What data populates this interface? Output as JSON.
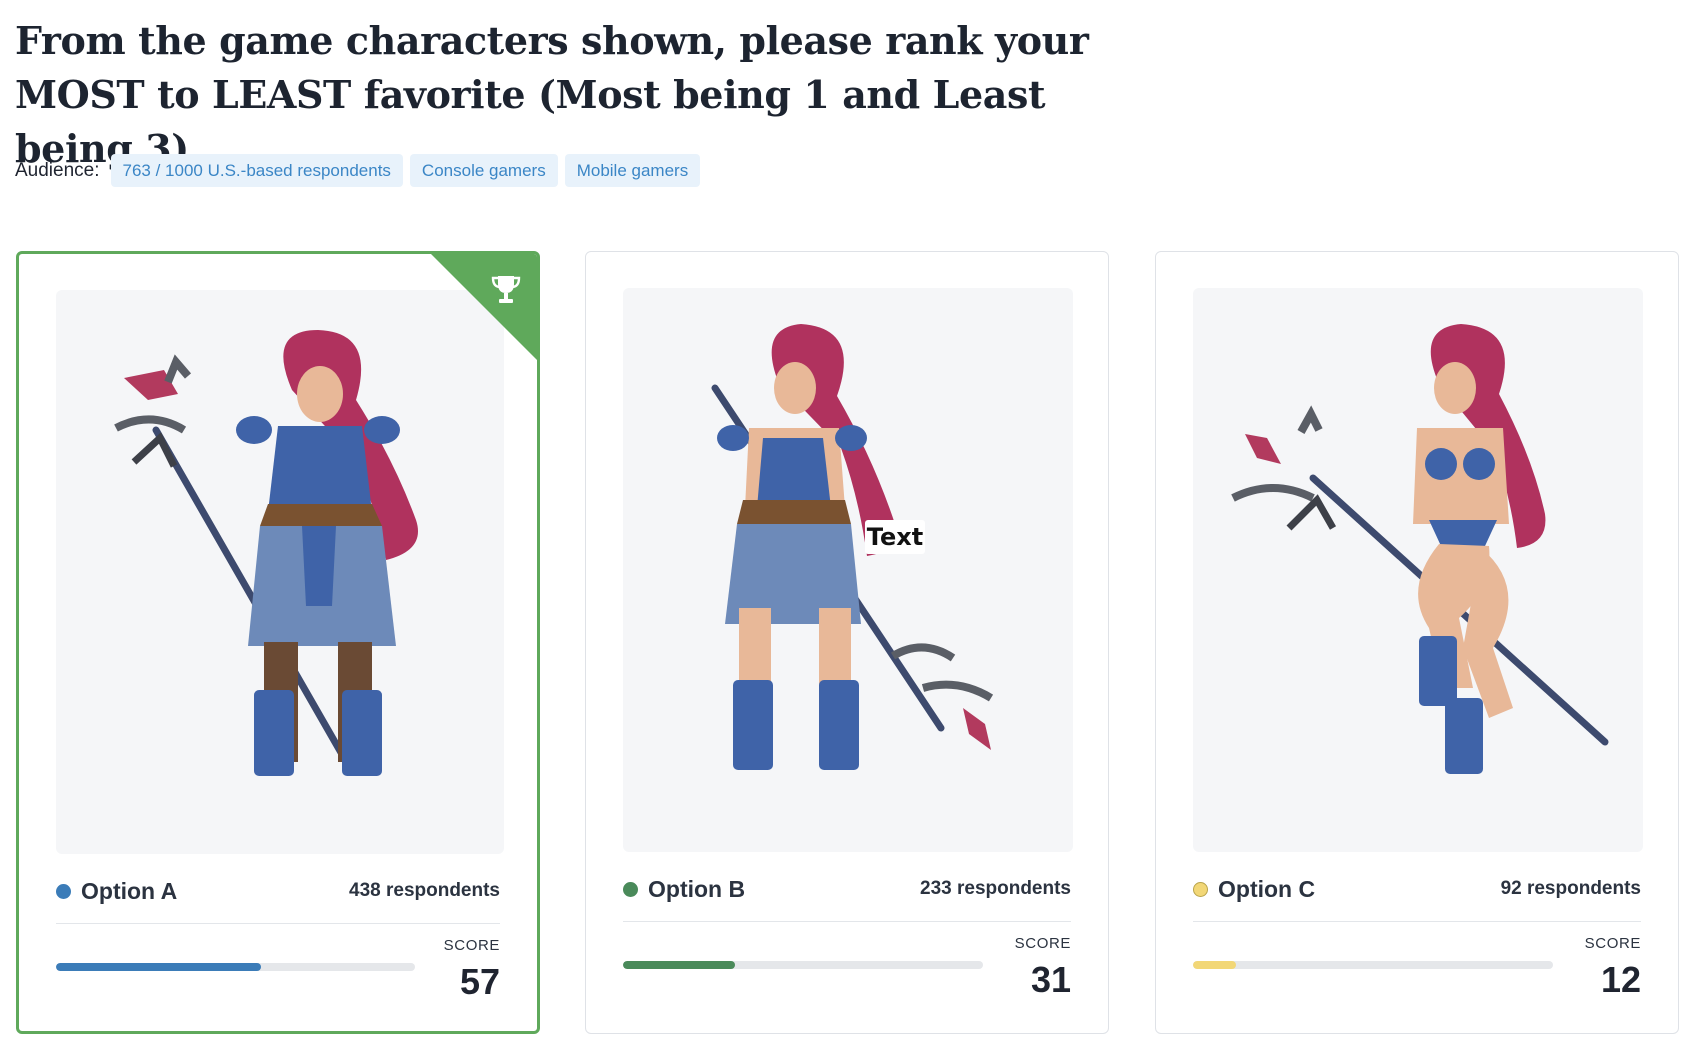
{
  "question": {
    "title": "From the game characters shown, please rank your MOST to LEAST favorite (Most being 1 and Least being 3)"
  },
  "audience": {
    "label": "Audience:",
    "chips": [
      "763 / 1000 U.S.-based respondents",
      "Console gamers",
      "Mobile gamers"
    ]
  },
  "options": [
    {
      "name": "Option A",
      "respondents": "438 respondents",
      "score_label": "SCORE",
      "score": "57",
      "score_fraction": 0.57,
      "color": "#3b7cb8",
      "winner": true,
      "winner_icon": "trophy-icon"
    },
    {
      "name": "Option B",
      "respondents": "233 respondents",
      "score_label": "SCORE",
      "score": "31",
      "score_fraction": 0.31,
      "color": "#4a8a5a",
      "winner": false,
      "image_overlay_text": "Text"
    },
    {
      "name": "Option C",
      "respondents": "92 respondents",
      "score_label": "SCORE",
      "score": "12",
      "score_fraction": 0.12,
      "color": "#f2d777",
      "winner": false
    }
  ],
  "colors": {
    "winner_accent": "#5fa95b",
    "chip_bg": "#e8f2fb",
    "chip_text": "#3b86c6"
  }
}
